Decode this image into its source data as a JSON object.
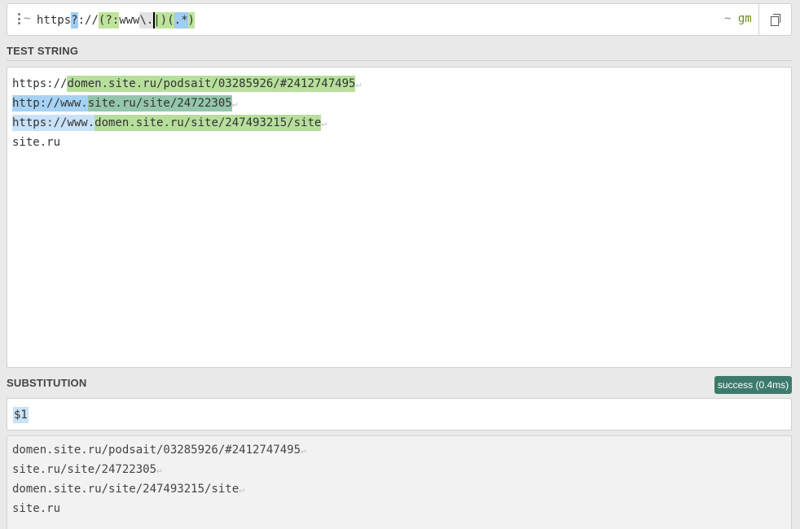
{
  "regex": {
    "delimiter_open": "~",
    "tokens": [
      {
        "text": "https",
        "kind": "lit"
      },
      {
        "text": "?",
        "kind": "q"
      },
      {
        "text": "://",
        "kind": "lit"
      },
      {
        "text": "(?:",
        "kind": "gnc"
      },
      {
        "text": "www",
        "kind": "lit"
      },
      {
        "text": "\\.",
        "kind": "esc"
      },
      {
        "text": "|",
        "kind": "alt"
      },
      {
        "text": ")",
        "kind": "gend"
      },
      {
        "text": "(",
        "kind": "gstart"
      },
      {
        "text": ".*",
        "kind": "dot"
      },
      {
        "text": ")",
        "kind": "gend"
      }
    ],
    "flags_delimiter": "~",
    "flags": "gm"
  },
  "labels": {
    "test_string": "TEST STRING",
    "substitution": "SUBSTITUTION"
  },
  "test_lines": [
    [
      {
        "text": "https://",
        "cls": "plain"
      },
      {
        "text": "domen.site.ru/podsait/03285926/#2412747495",
        "cls": "g1"
      }
    ],
    [
      {
        "text": "http://www.",
        "cls": "full"
      },
      {
        "text": "site.ru/site/24722305",
        "cls": "g1b"
      }
    ],
    [
      {
        "text": "https://www.",
        "cls": "ws"
      },
      {
        "text": "domen.site.ru/site/247493215/site",
        "cls": "g1"
      }
    ],
    [
      {
        "text": "site.ru",
        "cls": "plain"
      }
    ]
  ],
  "test_newline_marks": [
    true,
    true,
    true,
    false
  ],
  "status": "success (0.4ms)",
  "substitution_value": "$1",
  "result_lines": [
    "domen.site.ru/podsait/03285926/#2412747495",
    "site.ru/site/24722305",
    "domen.site.ru/site/247493215/site",
    "site.ru"
  ],
  "result_newline_marks": [
    true,
    true,
    true,
    false
  ],
  "newline_glyph": "↵",
  "colors": {
    "status_bg": "#3d7a6b",
    "group_match": "#b7df9c",
    "full_match": "#a6d2f3",
    "flags_text": "#6b8f28"
  },
  "icons": {
    "menu": "vertical-dots-icon",
    "copy": "copy-icon"
  }
}
